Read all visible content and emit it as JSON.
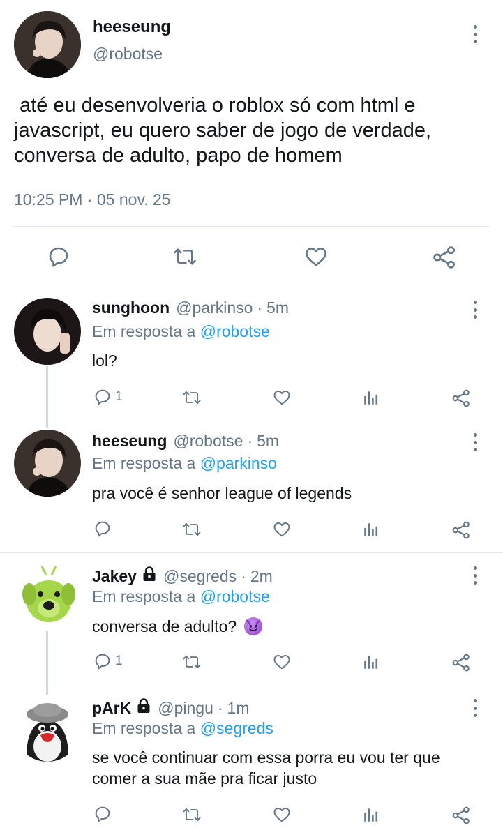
{
  "main_tweet": {
    "name": "heeseung",
    "handle": "@robotse",
    "text": " até eu desenvolveria o roblox só com html e javascript, eu quero saber de jogo de verdade, conversa de adulto, papo de homem",
    "timestamp": "10:25 PM · 05 nov. 25",
    "actions": [
      "reply-icon",
      "retweet-icon",
      "like-icon",
      "share-icon"
    ]
  },
  "replies": [
    {
      "name": "sunghoon",
      "handle": "@parkinso",
      "sep": "·",
      "time": "5m",
      "in_reply_prefix": "Em resposta a",
      "in_reply_to": "@robotse",
      "text": "lol?",
      "reply_count": "1",
      "locked": false
    },
    {
      "name": "heeseung",
      "handle": "@robotse",
      "sep": "·",
      "time": "5m",
      "in_reply_prefix": "Em resposta a",
      "in_reply_to": "@parkinso",
      "text": "pra você é senhor league of legends",
      "reply_count": "",
      "locked": false
    },
    {
      "name": "Jakey",
      "handle": "@segreds",
      "sep": "·",
      "time": "2m",
      "in_reply_prefix": "Em resposta a",
      "in_reply_to": "@robotse",
      "text": "conversa de adulto? ",
      "reply_count": "1",
      "locked": true,
      "emoji": "smiling-imp"
    },
    {
      "name": "pArK",
      "handle": "@pingu",
      "sep": "·",
      "time": "1m",
      "in_reply_prefix": "Em resposta a",
      "in_reply_to": "@segreds",
      "text": "se você continuar com essa porra eu vou ter que comer a sua mãe pra ficar justo",
      "reply_count": "",
      "locked": true
    }
  ],
  "colors": {
    "text": "#14171a",
    "secondary": "#657786",
    "link": "#1da1f2",
    "divider": "#e1e8ed"
  }
}
